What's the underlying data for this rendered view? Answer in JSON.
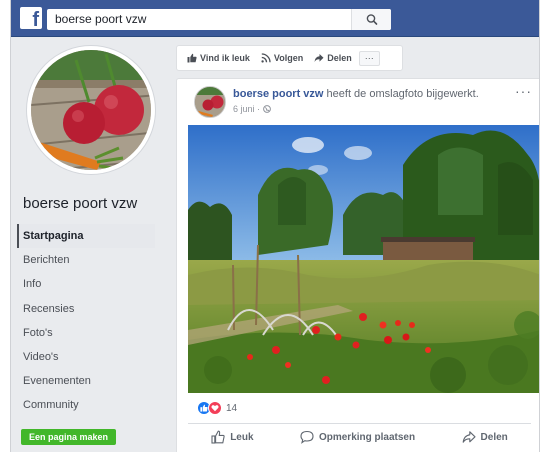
{
  "topbar": {
    "logo_letter": "f",
    "search_value": "boerse poort vzw"
  },
  "page": {
    "name": "boerse poort vzw"
  },
  "nav": {
    "items": [
      {
        "label": "Startpagina"
      },
      {
        "label": "Berichten"
      },
      {
        "label": "Info"
      },
      {
        "label": "Recensies"
      },
      {
        "label": "Foto's"
      },
      {
        "label": "Video's"
      },
      {
        "label": "Evenementen"
      },
      {
        "label": "Community"
      }
    ],
    "active_index": 0,
    "create_page_label": "Een pagina maken"
  },
  "action_bar": {
    "like_label": "Vind ik leuk",
    "follow_label": "Volgen",
    "share_label": "Delen",
    "more_label": "···"
  },
  "post": {
    "author": "boerse poort vzw",
    "action_text": "heeft de omslagfoto bijgewerkt.",
    "date": "6 juni ·",
    "menu_label": "···",
    "reaction_count": "14",
    "actions": {
      "like": "Leuk",
      "comment": "Opmerking plaatsen",
      "share": "Delen"
    }
  },
  "colors": {
    "brand": "#3b5998",
    "link": "#385898",
    "create_button": "#42b72a",
    "like_reaction": "#1877f2",
    "love_reaction": "#f33e58"
  },
  "icons": [
    "facebook-logo-icon",
    "search-icon",
    "thumbs-up-icon",
    "rss-icon",
    "share-arrow-icon",
    "globe-icon",
    "heart-icon",
    "comment-icon"
  ]
}
